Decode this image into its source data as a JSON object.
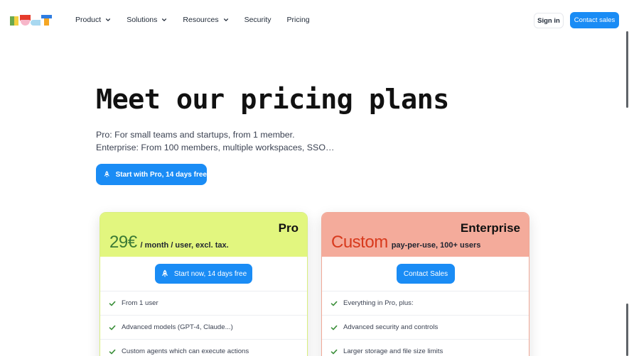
{
  "header": {
    "logo": "logo",
    "nav": [
      {
        "label": "Product",
        "has_dropdown": true
      },
      {
        "label": "Solutions",
        "has_dropdown": true
      },
      {
        "label": "Resources",
        "has_dropdown": true
      },
      {
        "label": "Security",
        "has_dropdown": false
      },
      {
        "label": "Pricing",
        "has_dropdown": false
      }
    ],
    "sign_in_label": "Sign in",
    "contact_label": "Contact sales"
  },
  "hero": {
    "title": "Meet our pricing plans",
    "subtitle_line1": "Pro: For small teams and startups, from 1 member.",
    "subtitle_line2": "Enterprise: From 100 members, multiple workspaces, SSO…",
    "cta_label": "Start with Pro, 14 days free",
    "cta_icon": "rocket-icon"
  },
  "plans": [
    {
      "name": "Pro",
      "price": "29€",
      "price_suffix": "/ month / user, excl. tax.",
      "button_label": "Start now, 14 days free",
      "button_icon": "rocket-icon",
      "features": [
        "From 1 user",
        "Advanced models (GPT-4, Claude...)",
        "Custom agents which can execute actions"
      ]
    },
    {
      "name": "Enterprise",
      "price": "Custom",
      "price_suffix": "pay-per-use, 100+ users",
      "button_label": "Contact Sales",
      "features": [
        "Everything in Pro, plus:",
        "Advanced security and controls",
        "Larger storage and file size limits"
      ]
    }
  ],
  "colors": {
    "accent": "#1a8cf5",
    "pro_header": "#e2f67f",
    "pro_price": "#3b7a35",
    "enterprise_header": "#f4ab9b",
    "enterprise_price": "#d83a1d",
    "check": "#3b8f3a"
  }
}
